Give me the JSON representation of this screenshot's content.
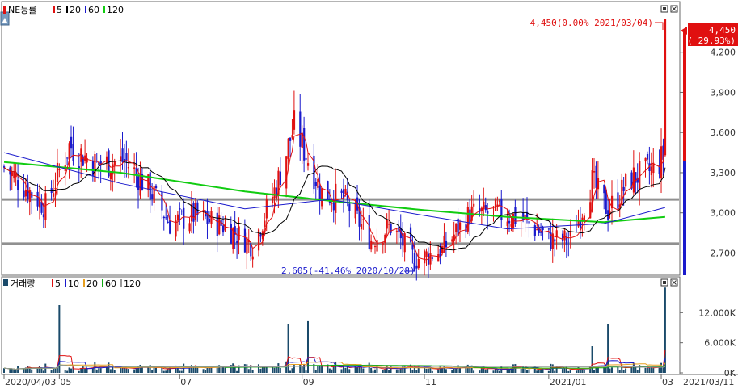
{
  "price_panel": {
    "legend": {
      "name": "NE능률",
      "mas": [
        {
          "label": "5",
          "color": "#e01010"
        },
        {
          "label": "20",
          "color": "#000000"
        },
        {
          "label": "60",
          "color": "#1a1acc"
        },
        {
          "label": "120",
          "color": "#11cc11"
        }
      ]
    },
    "current_price": "4,450",
    "current_change": "( 29.93%)",
    "high_annotation": "4,450(0.00% 2021/03/04)",
    "low_annotation": "2,605(-41.46% 2020/10/28)",
    "ytick_labels": [
      "4,200",
      "3,900",
      "3,600",
      "3,300",
      "3,000",
      "2,700"
    ]
  },
  "volume_panel": {
    "legend": {
      "name": "거래량",
      "mas": [
        {
          "label": "5",
          "color": "#e01010"
        },
        {
          "label": "10",
          "color": "#1a1acc"
        },
        {
          "label": "20",
          "color": "#e8a020"
        },
        {
          "label": "60",
          "color": "#11aa11"
        },
        {
          "label": "120",
          "color": "#999999"
        }
      ]
    },
    "ytick_labels": [
      "12,000K",
      "6,000K",
      "0K"
    ]
  },
  "xaxis": {
    "labels": [
      "2020/04/03",
      "05",
      "07",
      "09",
      "11",
      "2021/01",
      "03"
    ],
    "end_label": "2021/03/11"
  },
  "colors": {
    "up": "#e01010",
    "down": "#1a1acc",
    "ma5": "#e01010",
    "ma20": "#000000",
    "ma60": "#1a1acc",
    "ma120": "#11cc11",
    "hline": "#909090",
    "volume": "#1a4a6a"
  },
  "chart_data": {
    "type": "candlestick",
    "ticker": "NE능률",
    "x_range": [
      "2020/04/03",
      "2021/03/11"
    ],
    "y_range": [
      2540,
      4560
    ],
    "horizontal_lines": [
      3100,
      2770
    ],
    "price_path": [
      {
        "date": "2020/04/03",
        "close": 3340
      },
      {
        "date": "2020/04/24",
        "close": 3050
      },
      {
        "date": "2020/05/06",
        "close": 3500
      },
      {
        "date": "2020/05/20",
        "close": 3360
      },
      {
        "date": "2020/06/03",
        "close": 3390
      },
      {
        "date": "2020/06/17",
        "close": 3150
      },
      {
        "date": "2020/06/26",
        "close": 2920
      },
      {
        "date": "2020/07/08",
        "close": 2980
      },
      {
        "date": "2020/07/24",
        "close": 2900
      },
      {
        "date": "2020/08/07",
        "close": 2760
      },
      {
        "date": "2020/08/19",
        "close": 3200
      },
      {
        "date": "2020/08/28",
        "close": 3650
      },
      {
        "date": "2020/09/04",
        "close": 3400
      },
      {
        "date": "2020/09/11",
        "close": 3150
      },
      {
        "date": "2020/09/22",
        "close": 3100
      },
      {
        "date": "2020/10/06",
        "close": 2800
      },
      {
        "date": "2020/10/16",
        "close": 2900
      },
      {
        "date": "2020/10/28",
        "close": 2650
      },
      {
        "date": "2020/11/11",
        "close": 2720
      },
      {
        "date": "2020/11/25",
        "close": 2990
      },
      {
        "date": "2020/12/09",
        "close": 3000
      },
      {
        "date": "2020/12/22",
        "close": 2950
      },
      {
        "date": "2021/01/05",
        "close": 2800
      },
      {
        "date": "2021/01/15",
        "close": 2790
      },
      {
        "date": "2021/01/26",
        "close": 3230
      },
      {
        "date": "2021/02/03",
        "close": 3020
      },
      {
        "date": "2021/02/15",
        "close": 3260
      },
      {
        "date": "2021/02/26",
        "close": 3320
      },
      {
        "date": "2021/03/03",
        "close": 3420
      },
      {
        "date": "2021/03/04",
        "close": 4450
      }
    ],
    "ma120_path": [
      {
        "date": "2020/04/03",
        "value": 3380
      },
      {
        "date": "2020/06/01",
        "value": 3300
      },
      {
        "date": "2020/08/03",
        "value": 3160
      },
      {
        "date": "2020/09/15",
        "value": 3090
      },
      {
        "date": "2020/11/02",
        "value": 3020
      },
      {
        "date": "2020/12/14",
        "value": 2970
      },
      {
        "date": "2021/02/01",
        "value": 2930
      },
      {
        "date": "2021/03/04",
        "value": 2970
      }
    ],
    "ma60_path": [
      {
        "date": "2020/04/03",
        "value": 3450
      },
      {
        "date": "2020/06/01",
        "value": 3220
      },
      {
        "date": "2020/08/03",
        "value": 3030
      },
      {
        "date": "2020/09/15",
        "value": 3100
      },
      {
        "date": "2020/11/02",
        "value": 2980
      },
      {
        "date": "2020/12/14",
        "value": 2880
      },
      {
        "date": "2021/02/01",
        "value": 2920
      },
      {
        "date": "2021/03/04",
        "value": 3040
      }
    ],
    "volume": {
      "unit": "K",
      "ylim": [
        0,
        18000
      ],
      "spikes": [
        {
          "date": "2020/05/01",
          "value": 13500
        },
        {
          "date": "2020/08/25",
          "value": 9800
        },
        {
          "date": "2020/09/04",
          "value": 10300
        },
        {
          "date": "2021/01/26",
          "value": 5300
        },
        {
          "date": "2021/02/03",
          "value": 9700
        },
        {
          "date": "2021/03/04",
          "value": 17000
        }
      ]
    }
  }
}
